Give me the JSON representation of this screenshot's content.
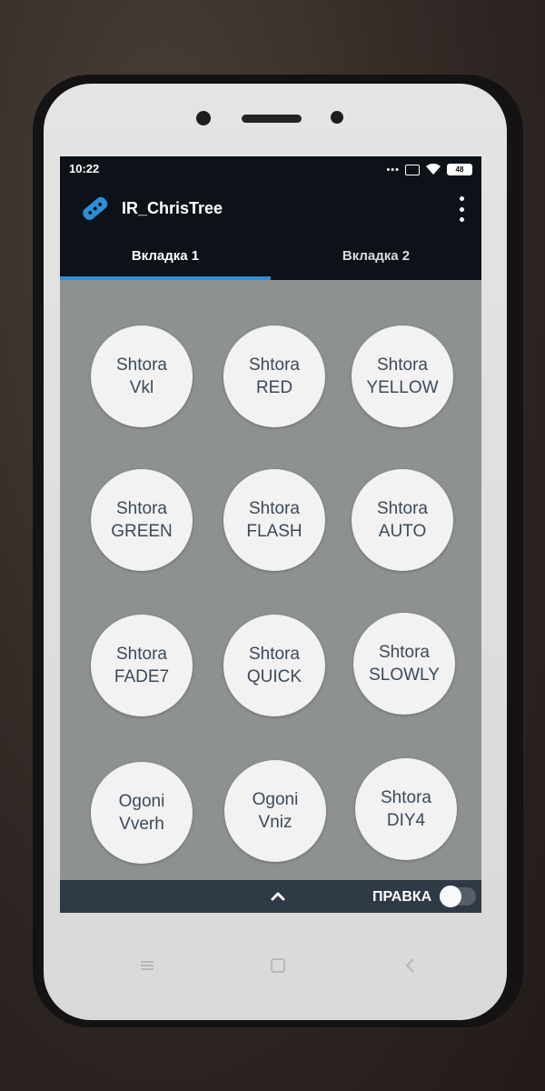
{
  "status_bar": {
    "time": "10:22",
    "signal_dots": "•••",
    "battery": "48"
  },
  "toolbar": {
    "app_icon": "remote-control-icon",
    "title": "IR_ChrisTree",
    "overflow_icon": "more-vert-icon"
  },
  "tabs": [
    {
      "label": "Вкладка 1",
      "selected": true
    },
    {
      "label": "Вкладка 2",
      "selected": false
    }
  ],
  "buttons": [
    {
      "line1": "Shtora",
      "line2": "Vkl"
    },
    {
      "line1": "Shtora",
      "line2": "RED"
    },
    {
      "line1": "Shtora",
      "line2": "YELLOW"
    },
    {
      "line1": "Shtora",
      "line2": "GREEN"
    },
    {
      "line1": "Shtora",
      "line2": "FLASH"
    },
    {
      "line1": "Shtora",
      "line2": "AUTO"
    },
    {
      "line1": "Shtora",
      "line2": "FADE7"
    },
    {
      "line1": "Shtora",
      "line2": "QUICK"
    },
    {
      "line1": "Shtora",
      "line2": "SLOWLY"
    },
    {
      "line1": "Ogoni",
      "line2": "Vverh"
    },
    {
      "line1": "Ogoni",
      "line2": "Vniz"
    },
    {
      "line1": "Shtora",
      "line2": "DIY4"
    }
  ],
  "bottom_bar": {
    "expand_icon": "chevron-up-icon",
    "edit_label": "ПРАВКА",
    "edit_toggle_on": false
  },
  "nav_keys": [
    "menu-icon",
    "home-icon",
    "back-icon"
  ],
  "colors": {
    "header": "#0d1219",
    "accent": "#2d8fd8",
    "screen_bg": "#8e9191",
    "button_bg": "#f2f2f2",
    "button_text": "#3a4a5a",
    "bottom_bar": "#2e3a46"
  }
}
